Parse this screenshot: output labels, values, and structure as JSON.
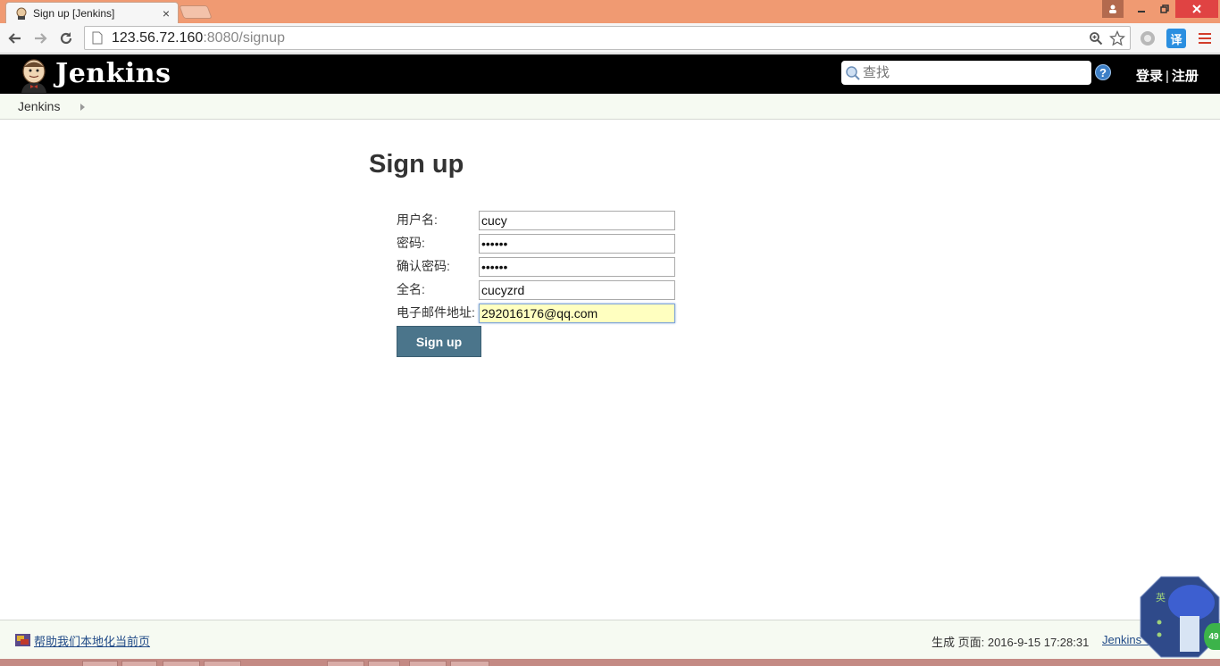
{
  "browser": {
    "tab_title": "Sign up [Jenkins]",
    "tab_close": "×",
    "url_host": "123.56.72.160",
    "url_rest": ":8080/signup",
    "translate_label": "译"
  },
  "header": {
    "brand": "Jenkins",
    "search_placeholder": "查找",
    "help_label": "?",
    "login_label": "登录",
    "separator": "|",
    "register_label": "注册"
  },
  "breadcrumb": {
    "items": [
      {
        "label": "Jenkins"
      }
    ]
  },
  "main": {
    "title": "Sign up",
    "fields": [
      {
        "label": "用户名:",
        "value": "cucy",
        "type": "text"
      },
      {
        "label": "密码:",
        "value": "••••••",
        "type": "password"
      },
      {
        "label": "确认密码:",
        "value": "••••••",
        "type": "password"
      },
      {
        "label": "全名:",
        "value": "cucyzrd",
        "type": "text"
      },
      {
        "label": "电子邮件地址:",
        "value": "292016176@qq.com",
        "type": "text"
      }
    ],
    "submit_label": "Sign up"
  },
  "footer": {
    "localize_link": "帮助我们本地化当前页",
    "generated": "生成 页面: 2016-9-15 17:28:31",
    "version_link": "Jenkins ver."
  },
  "overlay": {
    "ime_char": "英",
    "badge": "49"
  },
  "colors": {
    "titlebar": "#f09a72",
    "jenkins_header": "#000000",
    "breadcrumb_bg": "#f6faf2",
    "button": "#4b758b",
    "focused_input": "#ffffc0",
    "link": "#204a87"
  }
}
